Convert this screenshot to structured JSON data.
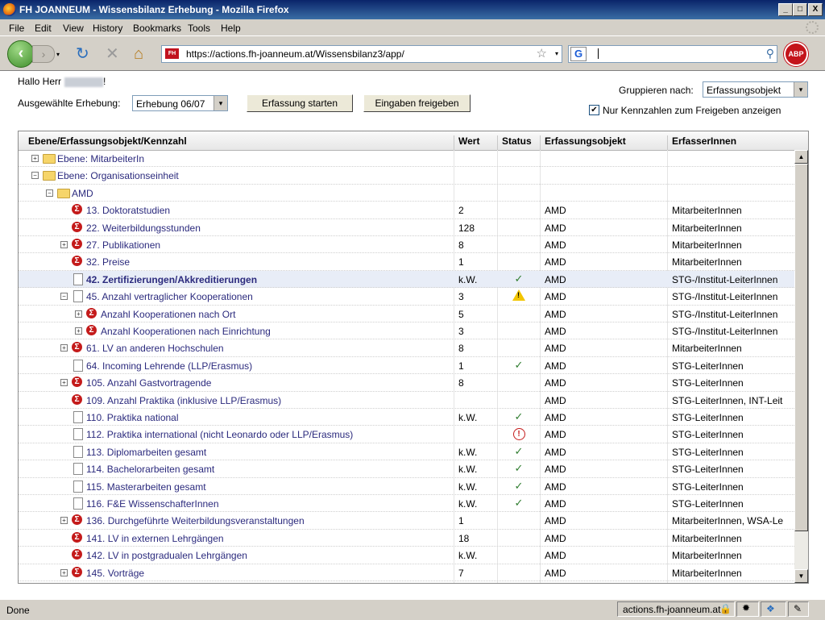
{
  "window": {
    "title": "FH JOANNEUM - Wissensbilanz Erhebung - Mozilla Firefox",
    "minimize": "_",
    "maximize": "□",
    "close": "X"
  },
  "menu": [
    "File",
    "Edit",
    "View",
    "History",
    "Bookmarks",
    "Tools",
    "Help"
  ],
  "nav": {
    "url": "https://actions.fh-joanneum.at/Wissensbilanz3/app/",
    "favicon_text": "FH",
    "search_engine": "G",
    "adblock": "ABP",
    "back": "‹",
    "forward": "›",
    "dropdown": "▾",
    "reload": "↻",
    "stop": "✕",
    "home": "⌂",
    "bookmark_star": "☆",
    "search_go": "⚲"
  },
  "page": {
    "greeting_prefix": "Hallo Herr",
    "greeting_suffix": "!",
    "erhebung_label": "Ausgewählte Erhebung:",
    "erhebung_value": "Erhebung 06/07",
    "start_button": "Erfassung starten",
    "release_button": "Eingaben freigeben",
    "group_label": "Gruppieren nach:",
    "group_value": "Erfassungsobjekt",
    "filter_check": "✔",
    "filter_label": "Nur Kennzahlen zum Freigeben anzeigen",
    "select_arrow": "▾"
  },
  "grid": {
    "columns": [
      "Ebene/Erfassungsobjekt/Kennzahl",
      "Wert",
      "Status",
      "Erfassungsobjekt",
      "ErfasserInnen"
    ],
    "scroll_up": "▲",
    "scroll_down": "▼",
    "rows": [
      {
        "label": "Ebene: MitarbeiterIn",
        "indent": 0,
        "toggle": "+",
        "icon": "folder",
        "wert": "",
        "status": "",
        "obj": "",
        "erf": ""
      },
      {
        "label": "Ebene: Organisationseinheit",
        "indent": 0,
        "toggle": "−",
        "icon": "folder",
        "wert": "",
        "status": "",
        "obj": "",
        "erf": ""
      },
      {
        "label": "AMD",
        "indent": 1,
        "toggle": "−",
        "icon": "folder",
        "wert": "",
        "status": "",
        "obj": "",
        "erf": ""
      },
      {
        "label": "13. Doktoratstudien",
        "indent": 2,
        "toggle": "",
        "icon": "sigma",
        "wert": "2",
        "status": "",
        "obj": "AMD",
        "erf": "MitarbeiterInnen"
      },
      {
        "label": "22. Weiterbildungsstunden",
        "indent": 2,
        "toggle": "",
        "icon": "sigma",
        "wert": "128",
        "status": "",
        "obj": "AMD",
        "erf": "MitarbeiterInnen"
      },
      {
        "label": "27. Publikationen",
        "indent": 2,
        "toggle": "+",
        "icon": "sigma",
        "wert": "8",
        "status": "",
        "obj": "AMD",
        "erf": "MitarbeiterInnen"
      },
      {
        "label": "32. Preise",
        "indent": 2,
        "toggle": "",
        "icon": "sigma",
        "wert": "1",
        "status": "",
        "obj": "AMD",
        "erf": "MitarbeiterInnen"
      },
      {
        "label": "42. Zertifizierungen/Akkreditierungen",
        "indent": 2,
        "toggle": "",
        "icon": "doc",
        "wert": "k.W.",
        "status": "✓",
        "obj": "AMD",
        "erf": "STG-/Institut-LeiterInnen",
        "selected": true
      },
      {
        "label": "45. Anzahl vertraglicher Kooperationen",
        "indent": 2,
        "toggle": "−",
        "icon": "doc",
        "wert": "3",
        "status": "!",
        "obj": "AMD",
        "erf": "STG-/Institut-LeiterInnen",
        "status_type": "warn"
      },
      {
        "label": "Anzahl Kooperationen nach Ort",
        "indent": 3,
        "toggle": "+",
        "icon": "sigma",
        "wert": "5",
        "status": "",
        "obj": "AMD",
        "erf": "STG-/Institut-LeiterInnen"
      },
      {
        "label": "Anzahl Kooperationen nach Einrichtung",
        "indent": 3,
        "toggle": "+",
        "icon": "sigma",
        "wert": "3",
        "status": "",
        "obj": "AMD",
        "erf": "STG-/Institut-LeiterInnen"
      },
      {
        "label": "61. LV an anderen Hochschulen",
        "indent": 2,
        "toggle": "+",
        "icon": "sigma",
        "wert": "8",
        "status": "",
        "obj": "AMD",
        "erf": "MitarbeiterInnen"
      },
      {
        "label": "64. Incoming Lehrende (LLP/Erasmus)",
        "indent": 2,
        "toggle": "",
        "icon": "doc",
        "wert": "1",
        "status": "✓",
        "obj": "AMD",
        "erf": "STG-LeiterInnen"
      },
      {
        "label": "105. Anzahl Gastvortragende",
        "indent": 2,
        "toggle": "+",
        "icon": "sigma",
        "wert": "8",
        "status": "",
        "obj": "AMD",
        "erf": "STG-LeiterInnen"
      },
      {
        "label": "109. Anzahl Praktika (inklusive LLP/Erasmus)",
        "indent": 2,
        "toggle": "",
        "icon": "sigma",
        "wert": "",
        "status": "",
        "obj": "AMD",
        "erf": "STG-LeiterInnen, INT-Leit"
      },
      {
        "label": "110. Praktika national",
        "indent": 2,
        "toggle": "",
        "icon": "doc",
        "wert": "k.W.",
        "status": "✓",
        "obj": "AMD",
        "erf": "STG-LeiterInnen"
      },
      {
        "label": "112. Praktika international (nicht Leonardo oder LLP/Erasmus)",
        "indent": 2,
        "toggle": "",
        "icon": "doc",
        "wert": "",
        "status": "!",
        "obj": "AMD",
        "erf": "STG-LeiterInnen",
        "status_type": "err"
      },
      {
        "label": "113. Diplomarbeiten gesamt",
        "indent": 2,
        "toggle": "",
        "icon": "doc",
        "wert": "k.W.",
        "status": "✓",
        "obj": "AMD",
        "erf": "STG-LeiterInnen"
      },
      {
        "label": "114. Bachelorarbeiten gesamt",
        "indent": 2,
        "toggle": "",
        "icon": "doc",
        "wert": "k.W.",
        "status": "✓",
        "obj": "AMD",
        "erf": "STG-LeiterInnen"
      },
      {
        "label": "115. Masterarbeiten gesamt",
        "indent": 2,
        "toggle": "",
        "icon": "doc",
        "wert": "k.W.",
        "status": "✓",
        "obj": "AMD",
        "erf": "STG-LeiterInnen"
      },
      {
        "label": "116. F&E WissenschafterInnen",
        "indent": 2,
        "toggle": "",
        "icon": "doc",
        "wert": "k.W.",
        "status": "✓",
        "obj": "AMD",
        "erf": "STG-LeiterInnen"
      },
      {
        "label": "136. Durchgeführte Weiterbildungsveranstaltungen",
        "indent": 2,
        "toggle": "+",
        "icon": "sigma",
        "wert": "1",
        "status": "",
        "obj": "AMD",
        "erf": "MitarbeiterInnen, WSA-Le"
      },
      {
        "label": "141. LV in externen Lehrgängen",
        "indent": 2,
        "toggle": "",
        "icon": "sigma",
        "wert": "18",
        "status": "",
        "obj": "AMD",
        "erf": "MitarbeiterInnen"
      },
      {
        "label": "142. LV in postgradualen Lehrgängen",
        "indent": 2,
        "toggle": "",
        "icon": "sigma",
        "wert": "k.W.",
        "status": "",
        "obj": "AMD",
        "erf": "MitarbeiterInnen"
      },
      {
        "label": "145. Vorträge",
        "indent": 2,
        "toggle": "+",
        "icon": "sigma",
        "wert": "7",
        "status": "",
        "obj": "AMD",
        "erf": "MitarbeiterInnen"
      }
    ]
  },
  "status": {
    "text": "Done",
    "host": "actions.fh-joanneum.at"
  }
}
